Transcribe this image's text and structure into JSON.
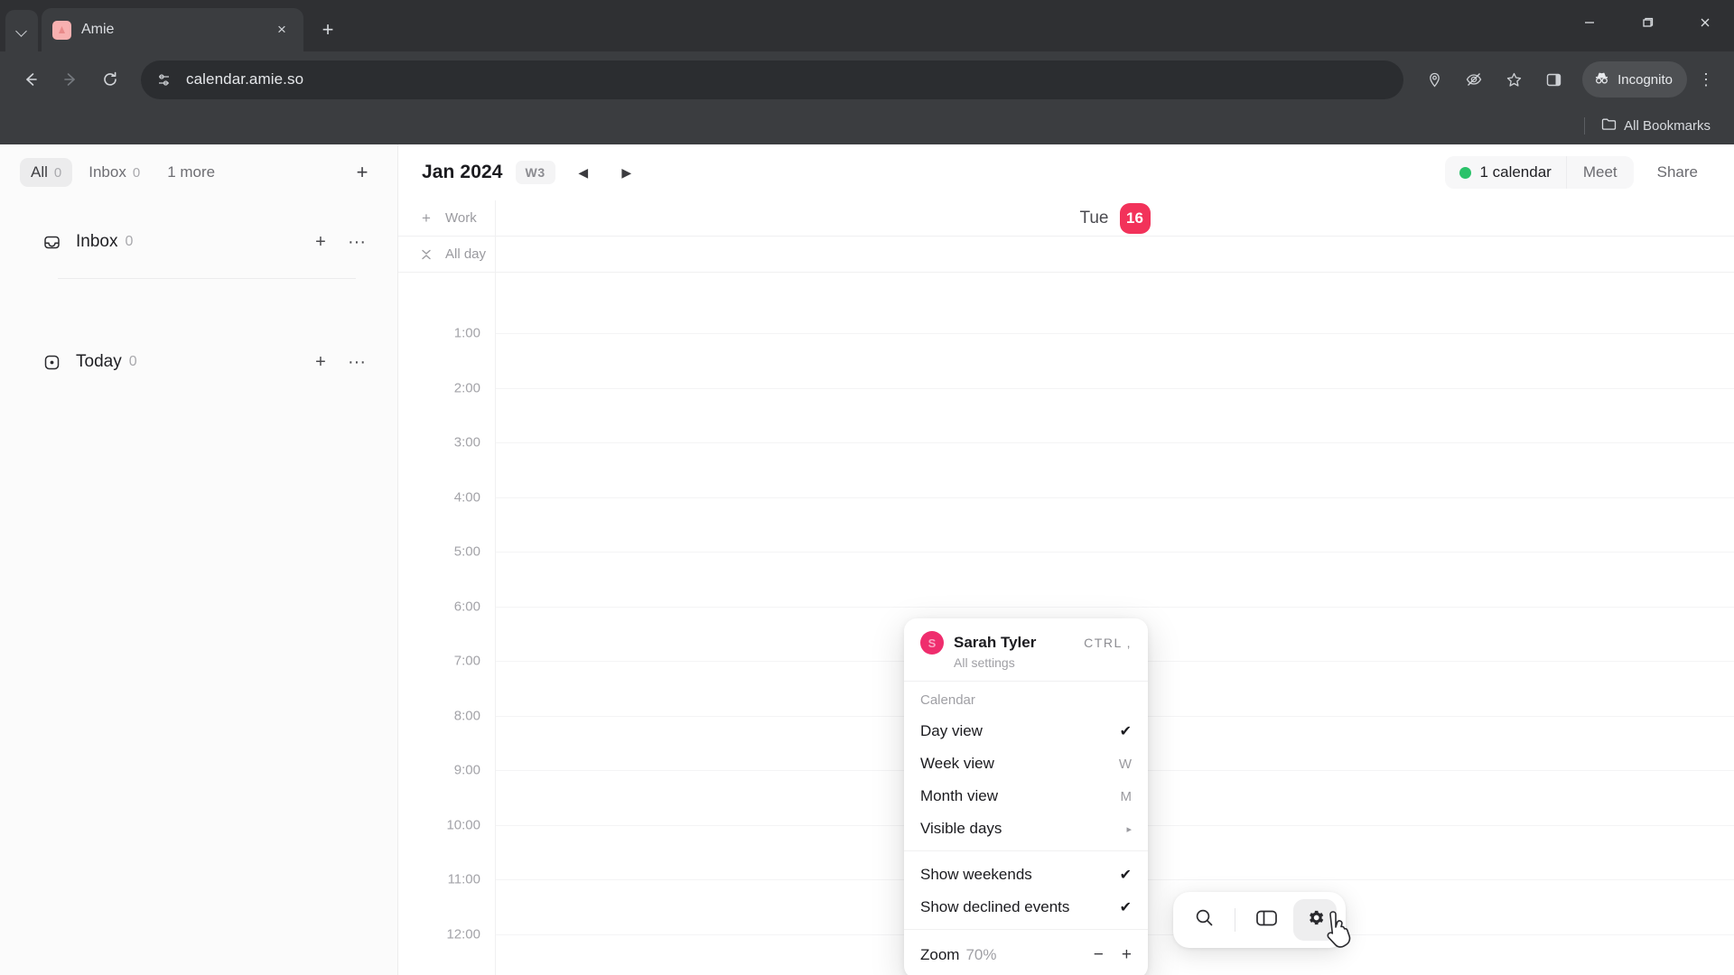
{
  "browser": {
    "tab": {
      "title": "Amie",
      "favicon_letter": "A",
      "close_label": "×"
    },
    "new_tab_label": "+",
    "window_controls": {
      "minimize": "–",
      "maximize": "❐",
      "close": "✕"
    },
    "nav": {
      "back": "←",
      "forward": "→",
      "reload": "↻"
    },
    "url": "calendar.amie.so",
    "omnibox_icon": "site-settings-icon",
    "toolbar_icons": [
      "location-pin-icon",
      "eye-off-icon",
      "bookmark-star-icon",
      "side-panel-icon"
    ],
    "profile_label": "Incognito",
    "menu_label": "⋮",
    "bookmarks": {
      "all_bookmarks_label": "All Bookmarks"
    }
  },
  "sidebar": {
    "tabs": [
      {
        "label": "All",
        "count": "0",
        "active": true
      },
      {
        "label": "Inbox",
        "count": "0",
        "active": false
      },
      {
        "label": "1 more",
        "count": "",
        "active": false
      }
    ],
    "add_label": "+",
    "groups": [
      {
        "label": "Inbox",
        "count": "0",
        "icon": "inbox-icon",
        "add": "+",
        "more": "···"
      },
      {
        "label": "Today",
        "count": "0",
        "icon": "today-icon",
        "add": "+",
        "more": "···"
      }
    ]
  },
  "calendar": {
    "month_label": "Jan 2024",
    "week_badge": "W3",
    "prev_label": "◀",
    "next_label": "▶",
    "calendars_label": "1 calendar",
    "calendar_color": "#2bc26a",
    "meet_label": "Meet",
    "share_label": "Share",
    "work_row": {
      "add": "+",
      "label": "Work"
    },
    "allday_row": {
      "collapse": "✕",
      "label": "All day"
    },
    "day": {
      "name": "Tue",
      "number": "16",
      "accent": "#f2325a"
    },
    "hours": [
      "1:00",
      "2:00",
      "3:00",
      "4:00",
      "5:00",
      "6:00",
      "7:00",
      "8:00",
      "9:00",
      "10:00",
      "11:00",
      "12:00"
    ]
  },
  "dock": {
    "search_icon": "search-icon",
    "panel_icon": "sidebar-toggle-icon",
    "settings_icon": "gear-icon"
  },
  "settings_menu": {
    "user": {
      "name": "Sarah Tyler",
      "initial": "S",
      "shortcut": "CTRL ,",
      "subtitle": "All settings"
    },
    "section_title": "Calendar",
    "view_items": [
      {
        "label": "Day view",
        "right": "✔",
        "type": "check"
      },
      {
        "label": "Week view",
        "right": "W",
        "type": "kbd"
      },
      {
        "label": "Month view",
        "right": "M",
        "type": "kbd"
      },
      {
        "label": "Visible days",
        "right": "▸",
        "type": "caret"
      }
    ],
    "toggle_items": [
      {
        "label": "Show weekends",
        "right": "✔",
        "type": "check"
      },
      {
        "label": "Show declined events",
        "right": "✔",
        "type": "check"
      }
    ],
    "zoom": {
      "label": "Zoom",
      "value": "70%",
      "minus": "−",
      "plus": "+"
    }
  }
}
